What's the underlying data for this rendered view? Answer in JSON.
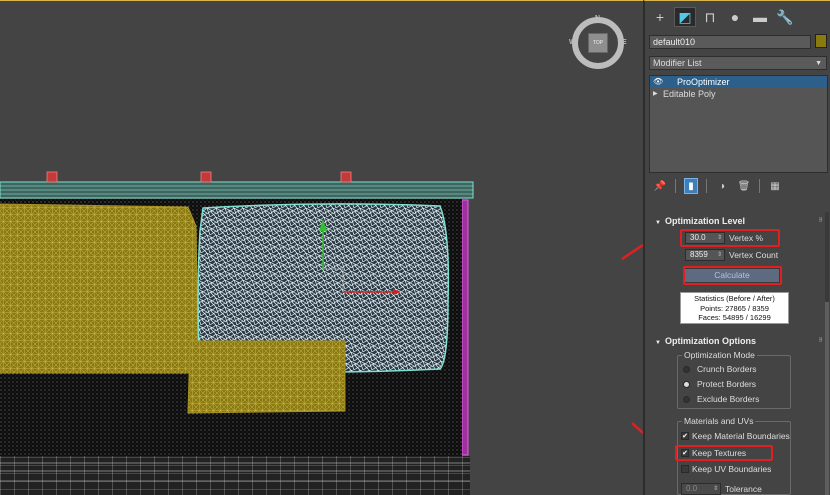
{
  "viewport": {
    "viewcube": {
      "face_label": "TOP",
      "north": "N",
      "south": "S",
      "east": "E",
      "west": "W"
    }
  },
  "panel": {
    "tabs": [
      {
        "name": "create",
        "glyph": "+"
      },
      {
        "name": "modify",
        "glyph": "◩"
      },
      {
        "name": "hierarchy",
        "glyph": "⊓"
      },
      {
        "name": "motion",
        "glyph": "●"
      },
      {
        "name": "display",
        "glyph": "▬"
      },
      {
        "name": "utilities",
        "glyph": "🔧"
      }
    ],
    "object_name": "default010",
    "object_color": "#8a7b0d",
    "modifier_list_label": "Modifier List",
    "stack": [
      {
        "label": "ProOptimizer",
        "selected": true
      },
      {
        "label": "Editable Poly",
        "selected": false
      }
    ],
    "optimization_level": {
      "title": "Optimization Level",
      "vertex_percent_value": "30.0",
      "vertex_percent_label": "Vertex %",
      "vertex_count_value": "8359",
      "vertex_count_label": "Vertex Count",
      "calculate_label": "Calculate",
      "stats_title": "Statistics (Before / After)",
      "stats_points": "Points: 27865 / 8359",
      "stats_faces": "Faces: 54895 / 16299"
    },
    "optimization_options": {
      "title": "Optimization Options",
      "mode_group_title": "Optimization Mode",
      "modes": [
        "Crunch Borders",
        "Protect Borders",
        "Exclude Borders"
      ],
      "selected_mode": 1,
      "materials_group_title": "Materials and UVs",
      "keep_material_boundaries": "Keep Material Boundaries",
      "keep_textures": "Keep Textures",
      "keep_uv_boundaries": "Keep UV Boundaries",
      "tolerance_value": "0.0",
      "tolerance_label": "Tolerance"
    }
  },
  "colors": {
    "accent_highlight": "#e02020",
    "selection_blue": "#2d5f8b",
    "wire_cyan": "#7fe0d0",
    "mesh_gold": "#8a7a12",
    "gizmo_y": "#30c030",
    "gizmo_x": "#d02020"
  }
}
